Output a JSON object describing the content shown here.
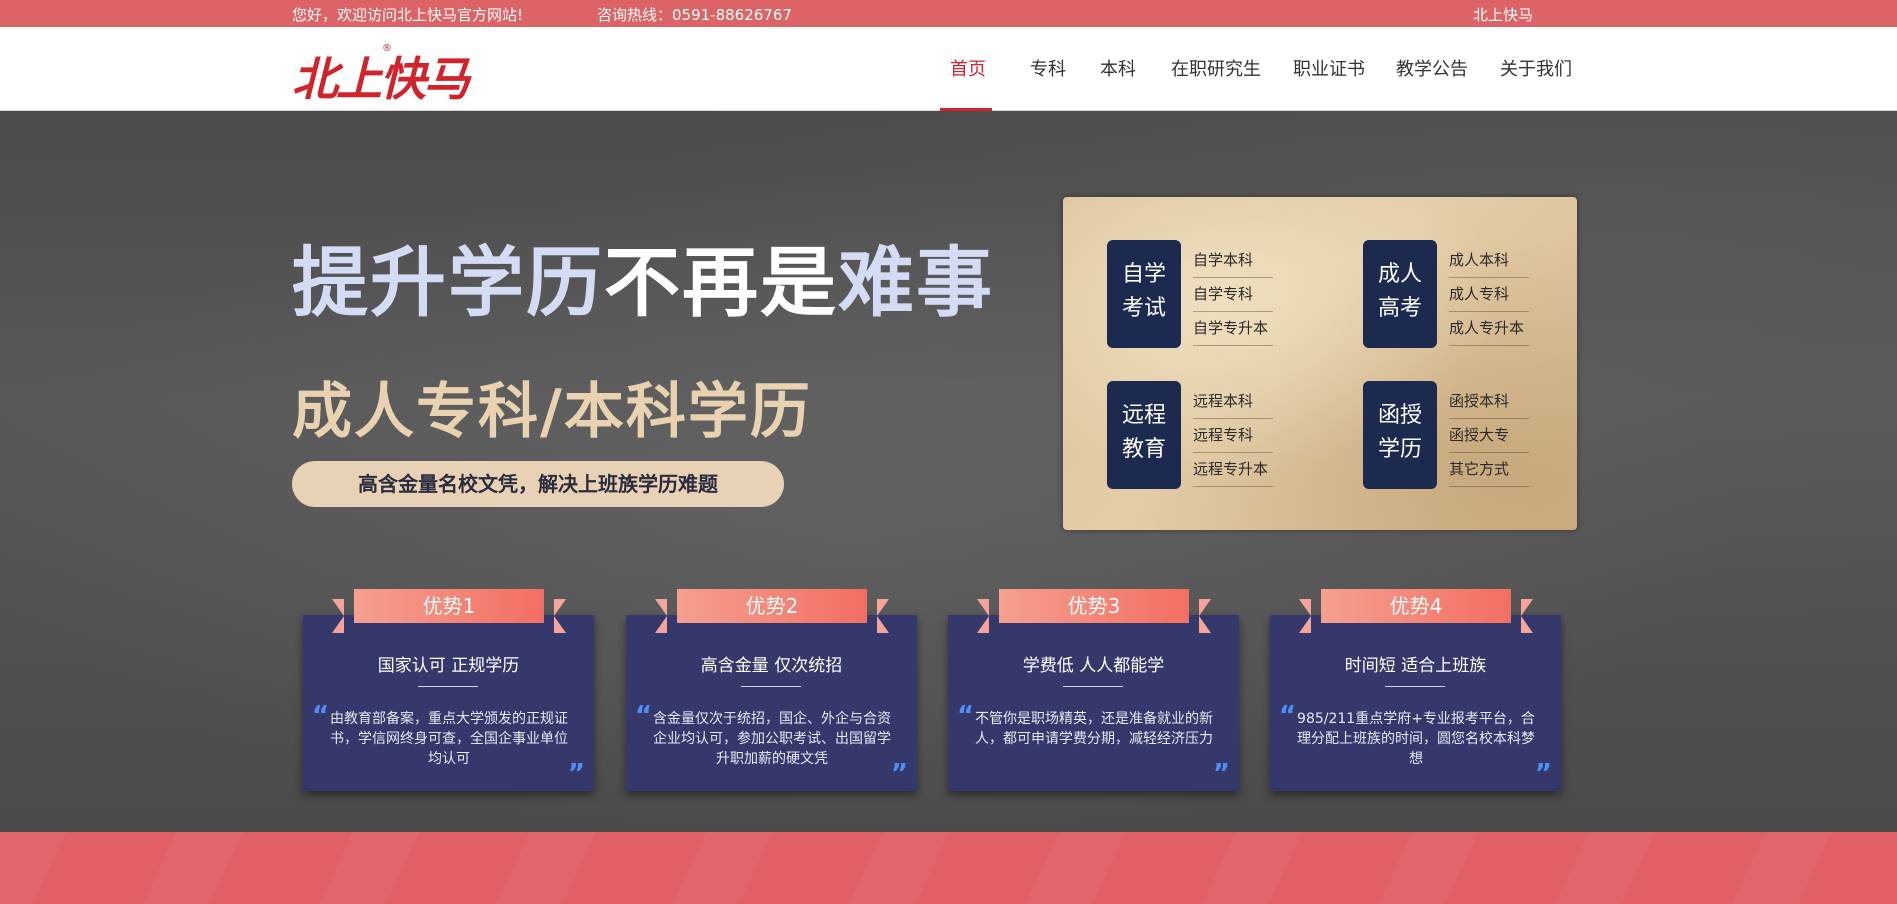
{
  "topbar": {
    "welcome": "您好，欢迎访问北上快马官方网站!",
    "hotline": "咨询热线：0591-88626767",
    "brand": "北上快马"
  },
  "header": {
    "logo_text": "北上快马",
    "logo_mark": "®",
    "nav": [
      "首页",
      "专科",
      "本科",
      "在职研究生",
      "职业证书",
      "教学公告",
      "关于我们"
    ],
    "active_nav": "首页"
  },
  "hero": {
    "headline_part1": "提升学历",
    "headline_part2": "不再是",
    "headline_part3": "难事",
    "subhead": "成人专科/本科学历",
    "pill": "高含金量名校文凭，解决上班族学历难题"
  },
  "categories": [
    {
      "line1": "自学",
      "line2": "考试",
      "links": [
        "自学本科",
        "自学专科",
        "自学专升本"
      ]
    },
    {
      "line1": "成人",
      "line2": "高考",
      "links": [
        "成人本科",
        "成人专科",
        "成人专升本"
      ]
    },
    {
      "line1": "远程",
      "line2": "教育",
      "links": [
        "远程本科",
        "远程专科",
        "远程专升本"
      ]
    },
    {
      "line1": "函授",
      "line2": "学历",
      "links": [
        "函授本科",
        "函授大专",
        "其它方式"
      ]
    }
  ],
  "advantages": [
    {
      "tag": "优势1",
      "title": "国家认可 正规学历",
      "body": "由教育部备案，重点大学颁发的正规证书，学信网终身可查，全国企事业单位均认可"
    },
    {
      "tag": "优势2",
      "title": "高含金量 仅次统招",
      "body": "含金量仅次于统招，国企、外企与合资企业均认可，参加公职考试、出国留学升职加薪的硬文凭"
    },
    {
      "tag": "优势3",
      "title": "学费低 人人都能学",
      "body": "不管你是职场精英，还是准备就业的新人，都可申请学费分期，减轻经济压力"
    },
    {
      "tag": "优势4",
      "title": "时间短 适合上班族",
      "body": "985/211重点学府+专业报考平台，合理分配上班族的时间，圆您名校本科梦想"
    }
  ],
  "colors": {
    "topbar": "#dc6466",
    "accent_red": "#d3232a",
    "card_bg": "#35386a",
    "category_box": "#1c2a4f",
    "pill_bg": "#e7d2b6"
  }
}
